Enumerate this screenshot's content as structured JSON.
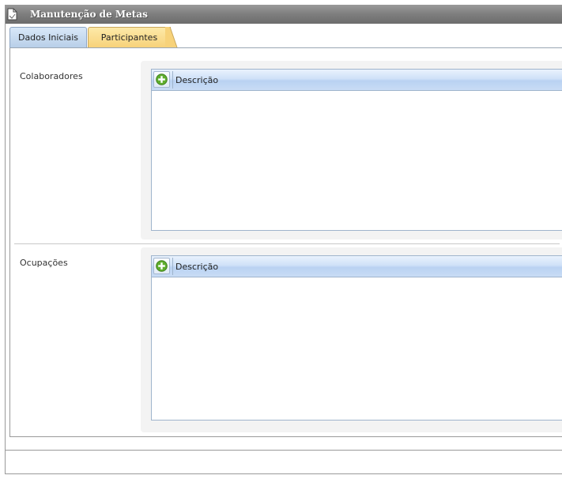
{
  "window": {
    "title": "Manutenção de Metas",
    "icon": "document-icon"
  },
  "tabs": [
    {
      "label": "Dados Iniciais",
      "active": false
    },
    {
      "label": "Participantes",
      "active": true
    }
  ],
  "sections": {
    "colaboradores": {
      "label": "Colaboradores",
      "grid": {
        "add_icon": "add-green-icon",
        "column_header": "Descrição",
        "rows": []
      }
    },
    "ocupacoes": {
      "label": "Ocupações",
      "grid": {
        "add_icon": "add-green-icon",
        "column_header": "Descrição",
        "rows": []
      }
    }
  },
  "colors": {
    "titlebar": "#7e7e7e",
    "active_tab": "#f7d27a",
    "inactive_tab": "#c8dcf2",
    "grid_header": "#cfe1f8",
    "add_button_green": "#5fae2e"
  }
}
